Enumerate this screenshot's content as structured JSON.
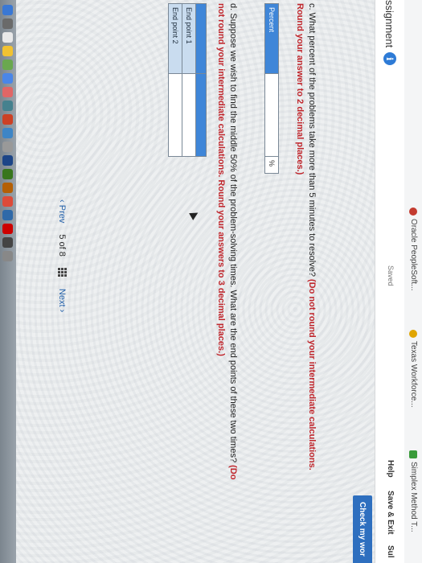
{
  "browser": {
    "bookmarks": [
      {
        "label": "Oracle PeopleSoft...",
        "color": "#c33b2f"
      },
      {
        "label": "Texas Workforce...",
        "color": "#e0a500"
      },
      {
        "label": "Simplex Method T...",
        "color": "#3a9b3a"
      }
    ]
  },
  "header": {
    "title": "ssignment",
    "saved": "Saved",
    "help": "Help",
    "save_exit": "Save & Exit",
    "submit": "Sul",
    "check": "Check my wor"
  },
  "question_c": {
    "text": "c. What percent of the problems take more than 5 minutes to resolve? ",
    "instruction": "(Do not round your intermediate calculations. Round your answer to 2 decimal places.)",
    "row_label": "Percent",
    "unit": "%",
    "value": ""
  },
  "question_d": {
    "text": "d. Suppose we wish to find the middle 50% of the problem-solving times. What are the end points of these two times? ",
    "instruction": "(Do not round your intermediate calculations. Round your answers to 3 decimal places.)",
    "rows": [
      {
        "label": "End point 1",
        "value": ""
      },
      {
        "label": "End point 2",
        "value": ""
      }
    ]
  },
  "pager": {
    "prev": "Prev",
    "current": "5",
    "of": "of",
    "total": "8",
    "next": "Next"
  },
  "colors": {
    "accent": "#2e6fbf",
    "table_header": "#3f86d8",
    "instruction_red": "#c0272d"
  }
}
